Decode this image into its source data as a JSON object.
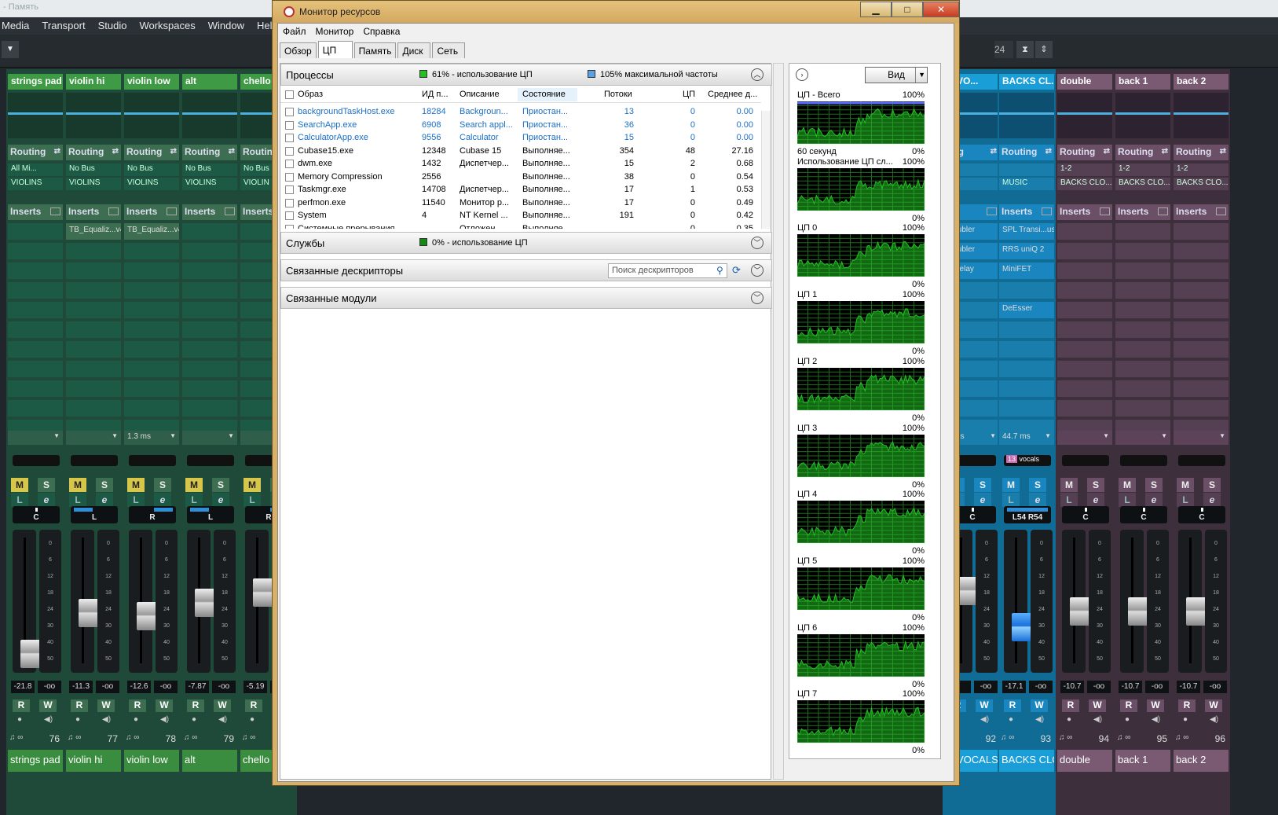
{
  "daw": {
    "title": "- Память",
    "menu": [
      "Media",
      "Transport",
      "Studio",
      "Workspaces",
      "Window",
      "Help"
    ],
    "toolbar_num": "24",
    "strips": [
      {
        "name": "strings pad",
        "routing": "Routing",
        "in1": "All Mi...",
        "in2": "VIOLINS",
        "inserts": "Inserts",
        "slots": [],
        "latency": "",
        "val1": "-21.8",
        "val2": "-oo",
        "num": "76",
        "foot": "strings pad",
        "pan": "C",
        "color": "green"
      },
      {
        "name": "violin hi",
        "routing": "Routing",
        "in1": "No Bus",
        "in2": "VIOLINS",
        "inserts": "Inserts",
        "slots": [
          "TB_Equaliz...v4"
        ],
        "latency": "",
        "val1": "-11.3",
        "val2": "-oo",
        "num": "77",
        "foot": "violin hi",
        "pan": "L",
        "color": "green"
      },
      {
        "name": "violin low",
        "routing": "Routing",
        "in1": "No Bus",
        "in2": "VIOLINS",
        "inserts": "Inserts",
        "slots": [
          "TB_Equaliz...v4"
        ],
        "latency": "1.3 ms",
        "val1": "-12.6",
        "val2": "-oo",
        "num": "78",
        "foot": "violin low",
        "pan": "R",
        "color": "green"
      },
      {
        "name": "alt",
        "routing": "Routing",
        "in1": "No Bus",
        "in2": "VIOLINS",
        "inserts": "Inserts",
        "slots": [],
        "latency": "",
        "val1": "-7.87",
        "val2": "-oo",
        "num": "79",
        "foot": "alt",
        "pan": "L",
        "color": "green"
      },
      {
        "name": "chello",
        "routing": "Routin",
        "in1": "No Bus",
        "in2": "VIOLIN",
        "inserts": "Inserts",
        "slots": [],
        "latency": "",
        "val1": "-5.19",
        "val2": "",
        "num": "",
        "foot": "chello",
        "pan": "R",
        "color": "green"
      },
      {
        "name": "D VO...",
        "routing": "ting",
        "in1": "",
        "in2": "SIC",
        "inserts": "rts",
        "slots": [
          "Doubler",
          "Doubler",
          "e Delay"
        ],
        "latency": "4 ms",
        "val1": "",
        "val2": "-oo",
        "num": "92",
        "foot": "D VOCALS",
        "pan": "C",
        "color": "blue"
      },
      {
        "name": "BACKS CL...",
        "routing": "Routing",
        "in1": "",
        "in2": "MUSIC",
        "inserts": "Inserts",
        "slots": [
          "SPL Transi...us",
          "RRS uniQ 2",
          "MiniFET",
          "",
          "DeEsser"
        ],
        "latency": "44.7 ms",
        "val1": "-17.1",
        "val2": "-oo",
        "num": "93",
        "foot": "BACKS CLOSE",
        "pan": "L54 R54",
        "group": "vocals",
        "group_num": "13",
        "color": "blue"
      },
      {
        "name": "double",
        "routing": "Routing",
        "in1": "1-2",
        "in2": "BACKS CLO...",
        "inserts": "Inserts",
        "slots": [],
        "latency": "",
        "val1": "-10.7",
        "val2": "-oo",
        "num": "94",
        "foot": "double",
        "pan": "C",
        "color": "mauve"
      },
      {
        "name": "back 1",
        "routing": "Routing",
        "in1": "1-2",
        "in2": "BACKS CLO...",
        "inserts": "Inserts",
        "slots": [],
        "latency": "",
        "val1": "-10.7",
        "val2": "-oo",
        "num": "95",
        "foot": "back 1",
        "pan": "C",
        "color": "mauve"
      },
      {
        "name": "back 2",
        "routing": "Routing",
        "in1": "1-2",
        "in2": "BACKS CLO...",
        "inserts": "Inserts",
        "slots": [],
        "latency": "",
        "val1": "-10.7",
        "val2": "-oo",
        "num": "96",
        "foot": "back 2",
        "pan": "C",
        "color": "mauve"
      }
    ],
    "buttons": {
      "mute": "M",
      "solo": "S",
      "listen": "L",
      "edit": "e",
      "read": "R",
      "write": "W"
    },
    "meter_scale": [
      "0",
      "6",
      "12",
      "18",
      "24",
      "30",
      "40",
      "50"
    ]
  },
  "rm": {
    "title": "Монитор ресурсов",
    "win_min": "▁",
    "win_max": "□",
    "win_close": "✕",
    "menu": [
      "Файл",
      "Монитор",
      "Справка"
    ],
    "tabs": [
      "Обзор",
      "ЦП",
      "Память",
      "Диск",
      "Сеть"
    ],
    "processes": {
      "title": "Процессы",
      "cpu_usage": "61% - использование ЦП",
      "max_freq": "105% максимальной частоты",
      "columns": [
        "Образ",
        "ИД п...",
        "Описание",
        "Состояние",
        "Потоки",
        "ЦП",
        "Среднее д..."
      ],
      "rows": [
        {
          "name": "backgroundTaskHost.exe",
          "pid": "18284",
          "desc": "Backgroun...",
          "state": "Приостан...",
          "threads": "13",
          "cpu": "0",
          "avg": "0.00",
          "suspended": true
        },
        {
          "name": "SearchApp.exe",
          "pid": "6908",
          "desc": "Search appl...",
          "state": "Приостан...",
          "threads": "36",
          "cpu": "0",
          "avg": "0.00",
          "suspended": true
        },
        {
          "name": "CalculatorApp.exe",
          "pid": "9556",
          "desc": "Calculator",
          "state": "Приостан...",
          "threads": "15",
          "cpu": "0",
          "avg": "0.00",
          "suspended": true
        },
        {
          "name": "Cubase15.exe",
          "pid": "12348",
          "desc": "Cubase 15",
          "state": "Выполняе...",
          "threads": "354",
          "cpu": "48",
          "avg": "27.16",
          "suspended": false
        },
        {
          "name": "dwm.exe",
          "pid": "1432",
          "desc": "Диспетчер...",
          "state": "Выполняе...",
          "threads": "15",
          "cpu": "2",
          "avg": "0.68",
          "suspended": false
        },
        {
          "name": "Memory Compression",
          "pid": "2556",
          "desc": "",
          "state": "Выполняе...",
          "threads": "38",
          "cpu": "0",
          "avg": "0.54",
          "suspended": false
        },
        {
          "name": "Taskmgr.exe",
          "pid": "14708",
          "desc": "Диспетчер...",
          "state": "Выполняе...",
          "threads": "17",
          "cpu": "1",
          "avg": "0.53",
          "suspended": false
        },
        {
          "name": "perfmon.exe",
          "pid": "11540",
          "desc": "Монитор р...",
          "state": "Выполняе...",
          "threads": "17",
          "cpu": "0",
          "avg": "0.49",
          "suspended": false
        },
        {
          "name": "System",
          "pid": "4",
          "desc": "NT Kernel ...",
          "state": "Выполняе...",
          "threads": "191",
          "cpu": "0",
          "avg": "0.42",
          "suspended": false
        },
        {
          "name": "Системные прерывания",
          "pid": "",
          "desc": "Отложен...",
          "state": "Выполняе...",
          "threads": "",
          "cpu": "0",
          "avg": "0.35",
          "suspended": false
        }
      ]
    },
    "services": {
      "title": "Службы",
      "cpu_usage": "0% - использование ЦП"
    },
    "handles": {
      "title": "Связанные дескрипторы",
      "search_placeholder": "Поиск дескрипторов"
    },
    "modules": {
      "title": "Связанные модули"
    },
    "view_button": "Вид",
    "graphs": [
      {
        "title": "ЦП - Всего",
        "max": "100%",
        "min": "0%",
        "sub": "60 секунд"
      },
      {
        "title": "Использование ЦП сл...",
        "max": "100%",
        "min": "0%",
        "sub": ""
      },
      {
        "title": "ЦП 0",
        "max": "100%",
        "min": "0%",
        "sub": ""
      },
      {
        "title": "ЦП 1",
        "max": "100%",
        "min": "0%",
        "sub": ""
      },
      {
        "title": "ЦП 2",
        "max": "100%",
        "min": "0%",
        "sub": ""
      },
      {
        "title": "ЦП 3",
        "max": "100%",
        "min": "0%",
        "sub": ""
      },
      {
        "title": "ЦП 4",
        "max": "100%",
        "min": "0%",
        "sub": ""
      },
      {
        "title": "ЦП 5",
        "max": "100%",
        "min": "0%",
        "sub": ""
      },
      {
        "title": "ЦП 6",
        "max": "100%",
        "min": "0%",
        "sub": ""
      },
      {
        "title": "ЦП 7",
        "max": "100%",
        "min": "0%",
        "sub": ""
      }
    ],
    "colors": {
      "cpu_green": "#22c022",
      "freq_blue": "#5aa0e6",
      "graph_bg": "#000000",
      "graph_grid": "#1e6b1e"
    }
  }
}
